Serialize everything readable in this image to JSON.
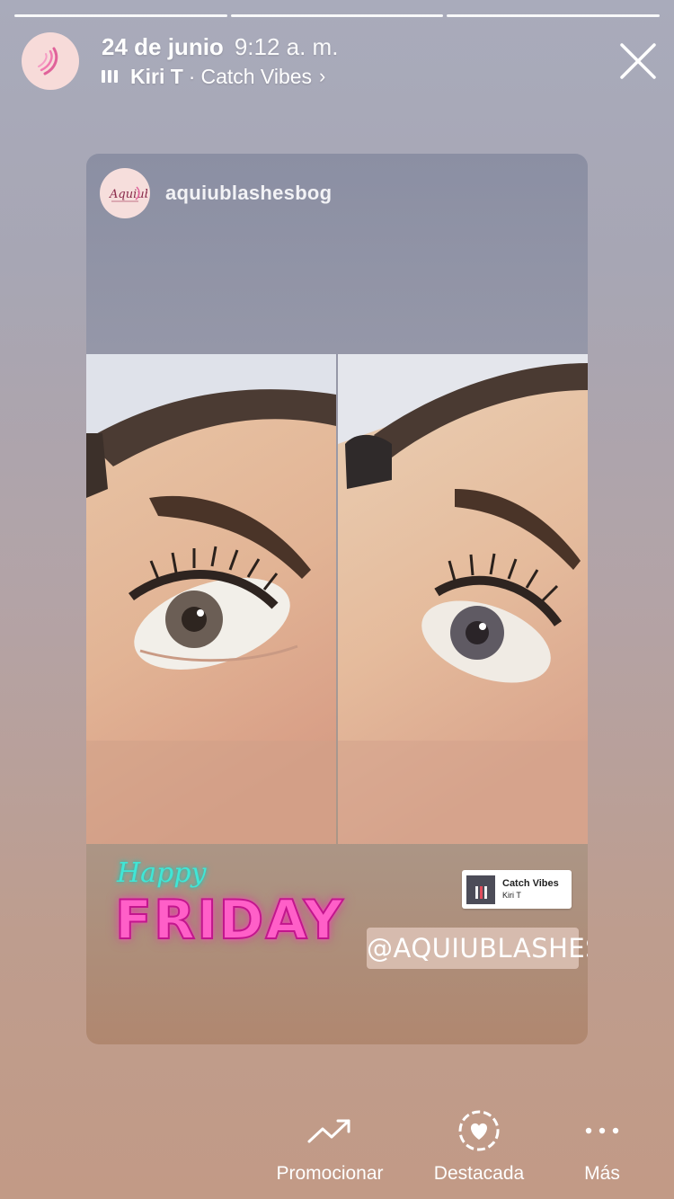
{
  "story": {
    "progress_segments": 3,
    "date": "24 de junio",
    "time": "9:12 a. m.",
    "music_artist": "Kiri T",
    "separator": "·",
    "music_song": "Catch Vibes",
    "chevron": "›"
  },
  "icons": {
    "close": "close-icon",
    "music": "music-bars-icon",
    "promote": "trending-up-icon",
    "highlight": "heart-circle-icon",
    "more": "more-dots-icon"
  },
  "card": {
    "username": "aquiublashesbog",
    "sticker_happy": "Happy",
    "sticker_friday": "FRIDAY",
    "music_sticker_song": "Catch Vibes",
    "music_sticker_artist": "Kiri T",
    "mention": "@AQUIUBLASHES"
  },
  "actions": {
    "promote": "Promocionar",
    "highlight": "Destacada",
    "more": "Más"
  },
  "colors": {
    "background_top": "#a9abbb",
    "background_bottom": "#c29a86",
    "friday_pink": "#ff5fc8",
    "happy_teal": "#40e6d6"
  }
}
